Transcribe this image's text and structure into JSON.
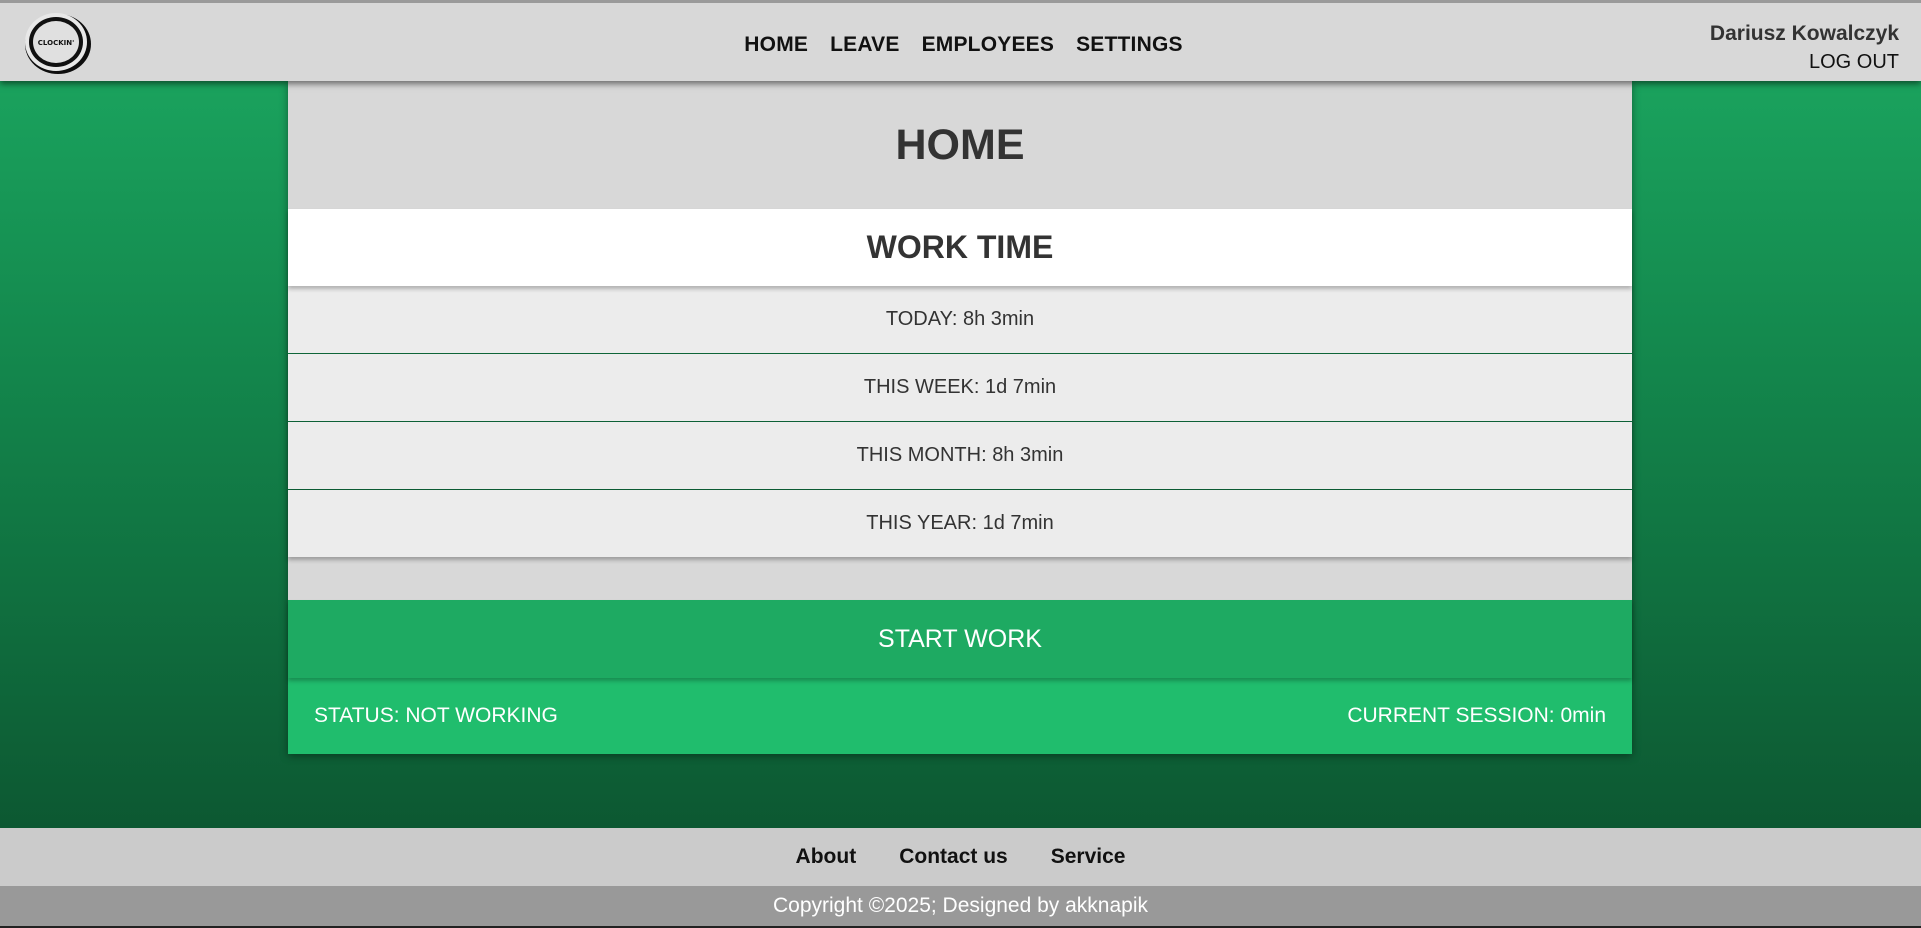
{
  "header": {
    "logo_text": "CLOCKIN'",
    "nav": [
      "HOME",
      "LEAVE",
      "EMPLOYEES",
      "SETTINGS"
    ],
    "user_name": "Dariusz Kowalczyk",
    "logout_label": "LOG OUT"
  },
  "main": {
    "title": "HOME",
    "section_title": "WORK TIME",
    "stats": [
      "TODAY: 8h 3min",
      "THIS WEEK: 1d 7min",
      "THIS MONTH: 8h 3min",
      "THIS YEAR: 1d 7min"
    ],
    "start_button": "START WORK",
    "status": "STATUS: NOT WORKING",
    "current_session": "CURRENT SESSION: 0min"
  },
  "footer": {
    "links": [
      "About",
      "Contact us",
      "Service"
    ],
    "copyright": "Copyright ©2025; Designed by akknapik"
  },
  "colors": {
    "accent": "#1eaa62",
    "status_bar": "#20bd6d",
    "header_bg": "#d8d8d8"
  },
  "icons": {
    "logo": "clock-ring-logo"
  }
}
